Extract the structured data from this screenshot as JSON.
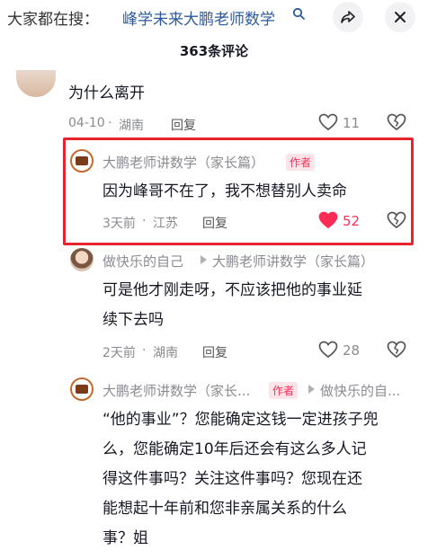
{
  "search": {
    "prefix": "大家都在搜：",
    "query": "峰学未来大鹏老师数学"
  },
  "header": {
    "comment_count": "363条评论"
  },
  "comments": [
    {
      "text": "为什么离开",
      "date": "04-10",
      "location": "湖南",
      "reply": "回复",
      "likes": "11"
    },
    {
      "username": "大鹏老师讲数学（家长篇）",
      "badge": "作者",
      "text": "因为峰哥不在了，我不想替别人卖命",
      "date": "3天前",
      "location": "江苏",
      "reply": "回复",
      "likes": "52",
      "liked": true
    },
    {
      "username": "做快乐的自己",
      "reply_to": "大鹏老师讲数学（家长篇）",
      "text_line1": "可是他才刚走呀，不应该把他的事业延",
      "text_line2": "续下去吗",
      "date": "2天前",
      "location": "湖南",
      "reply": "回复",
      "likes": "28"
    },
    {
      "username": "大鹏老师讲数学（家长...",
      "badge": "作者",
      "reply_to": "做快乐的自...",
      "text_line1": "“他的事业”？您能确定这钱一定进孩子兜",
      "text_line2": "么，您能确定10年后还会有这么多人记",
      "text_line3": "得这件事吗？关注这件事吗？您现在还",
      "text_line4": "能想起十年前和您非亲属关系的什么",
      "text_line5": "事？姐"
    }
  ],
  "colors": {
    "accent_red": "#fe2c55",
    "highlight_border": "#e8242f",
    "link_blue": "#2b5a9e",
    "meta_gray": "#8a8b91"
  },
  "icons": {
    "search": "search-icon",
    "share": "share-icon",
    "close": "close-icon",
    "like": "heart-icon",
    "dislike": "broken-heart-icon",
    "reply_arrow": "triangle-right-icon"
  }
}
